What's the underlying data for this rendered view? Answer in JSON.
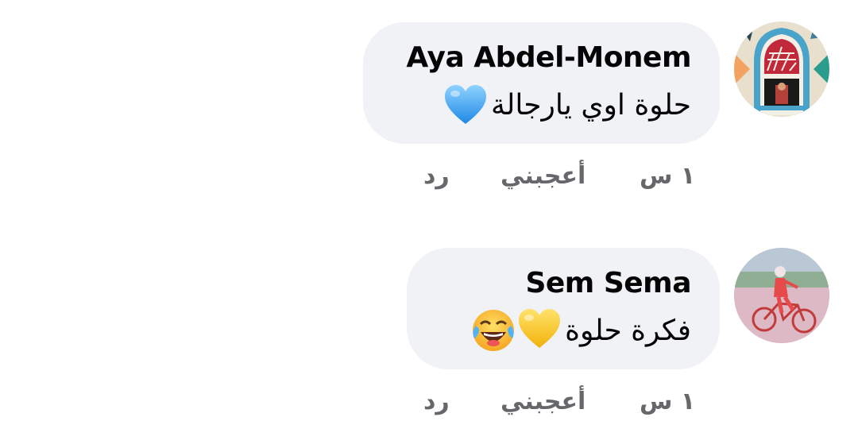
{
  "comments": [
    {
      "author": "Aya Abdel-Monem",
      "text": "حلوة اوي يارجالة",
      "emojis": [
        "blue-heart"
      ],
      "time": "١ س",
      "like_label": "أعجبني",
      "reply_label": "رد"
    },
    {
      "author": "Sem Sema",
      "text": "فكرة حلوة",
      "emojis": [
        "yellow-heart",
        "laughing-tears"
      ],
      "time": "١ س",
      "like_label": "أعجبني",
      "reply_label": "رد"
    }
  ],
  "colors": {
    "bubble_bg": "#f0f2f5",
    "author_text": "#050505",
    "action_text": "#65676b"
  }
}
